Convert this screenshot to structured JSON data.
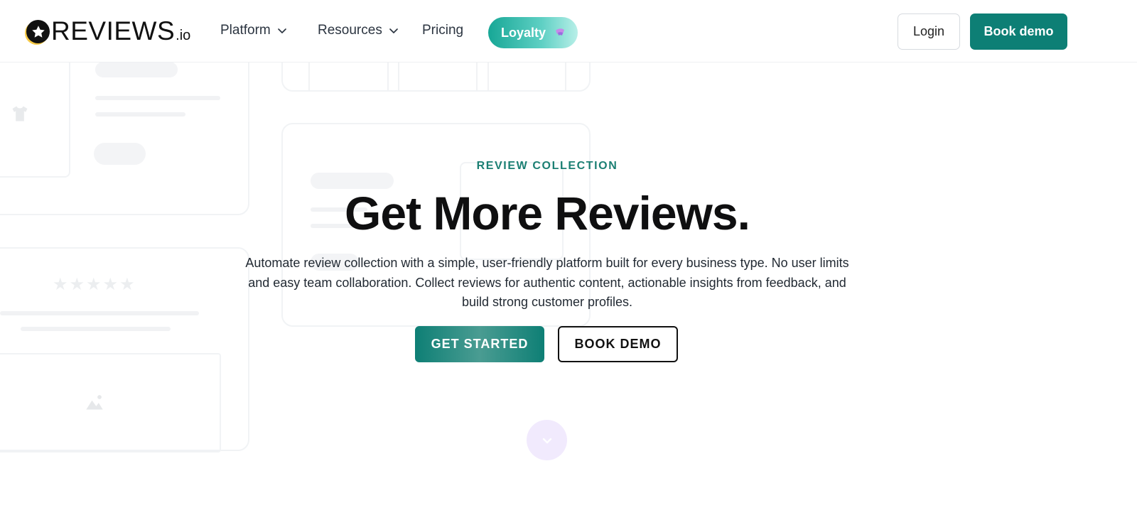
{
  "nav": {
    "logo": {
      "word": "REVIEWS",
      "tld": ".io"
    },
    "links": [
      {
        "label": "Platform",
        "dropdown": true
      },
      {
        "label": "Resources",
        "dropdown": true
      },
      {
        "label": "Pricing",
        "dropdown": false
      }
    ],
    "loyalty_label": "Loyalty",
    "login_label": "Login",
    "book_demo_label": "Book demo"
  },
  "hero": {
    "eyebrow": "REVIEW COLLECTION",
    "headline": "Get More Reviews.",
    "subtext": "Automate review collection with a simple, user-friendly platform built for every business type. No user limits and easy team collaboration. Collect reviews for authentic content, actionable insights from feedback, and build strong customer profiles.",
    "cta_primary": "GET STARTED",
    "cta_secondary": "BOOK DEMO"
  },
  "icons": {
    "logo": "star-badge-icon",
    "dropdown": "chevron-down-icon",
    "loyalty": "sparkle-icon",
    "scroll": "chevron-down-icon",
    "placeholder_shirt": "shirt-icon",
    "placeholder_image": "image-icon",
    "placeholder_stars": "star-rating-icon"
  },
  "colors": {
    "brand_teal": "#0d7f75",
    "eyebrow_teal": "#1b7f73",
    "loyalty_gradient_start": "#17a796",
    "scroll_button_bg": "#f1eafd",
    "logo_accent": "#f6c945"
  }
}
